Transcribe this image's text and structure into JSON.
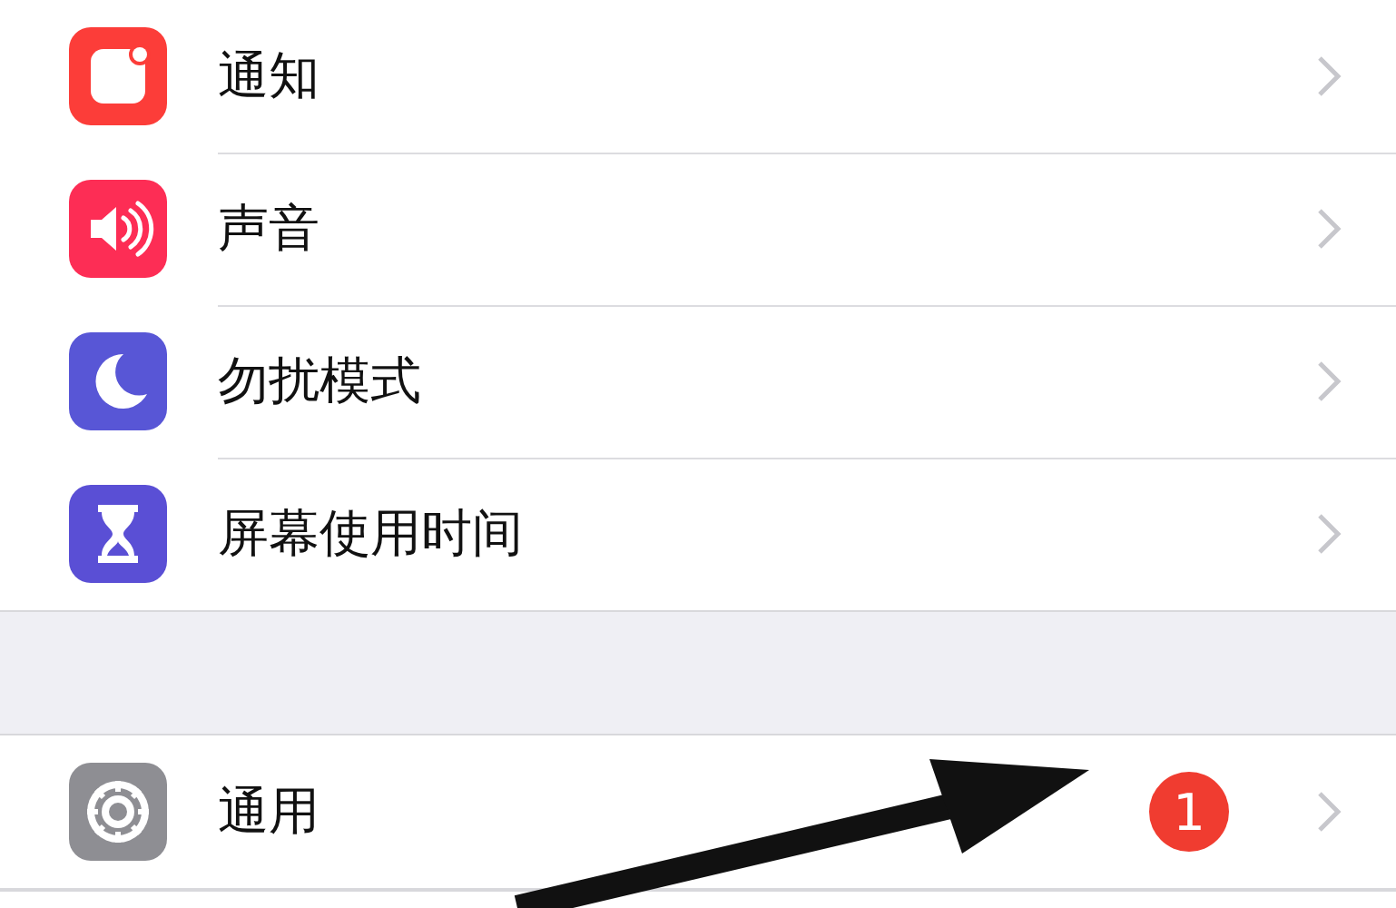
{
  "groups": [
    {
      "rows": [
        {
          "kind": "notifications",
          "label": "通知"
        },
        {
          "kind": "sound",
          "label": "声音"
        },
        {
          "kind": "moon",
          "label": "勿扰模式"
        },
        {
          "kind": "hourglass",
          "label": "屏幕使用时间"
        }
      ]
    },
    {
      "rows": [
        {
          "kind": "gear",
          "label": "通用",
          "badge": "1"
        }
      ]
    }
  ]
}
